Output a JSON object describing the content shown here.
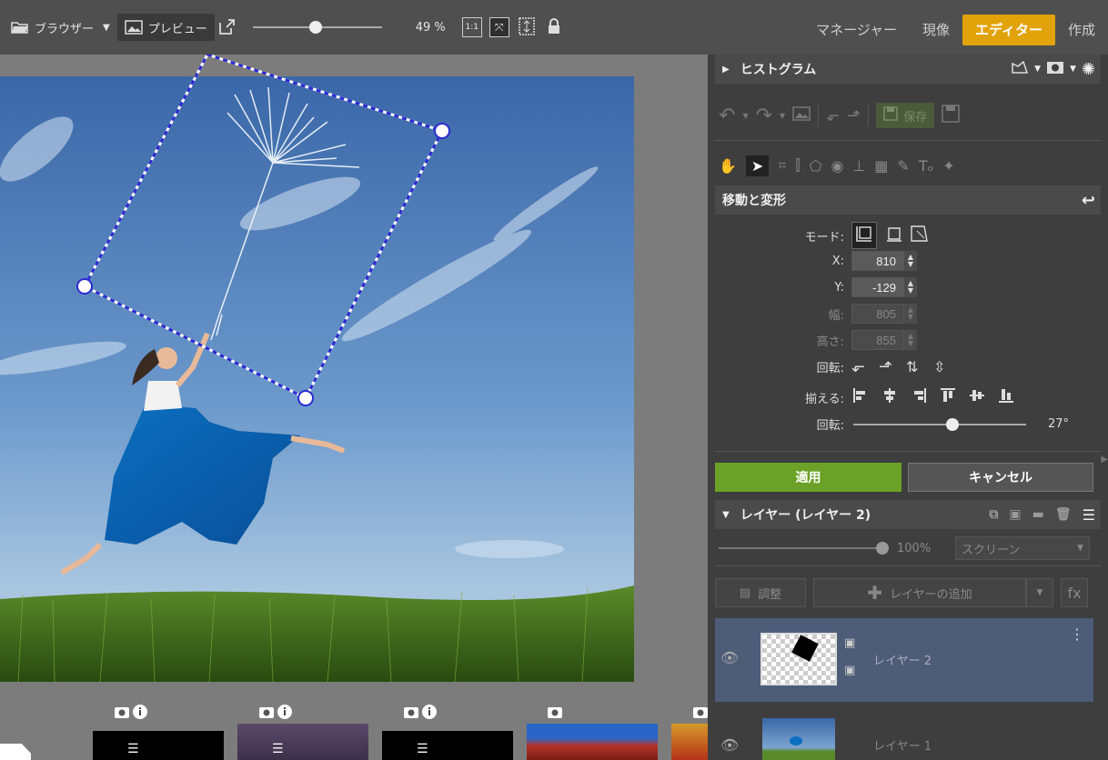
{
  "topbar": {
    "browser_label": "ブラウザー",
    "preview_label": "プレビュー",
    "zoom_value": 49,
    "zoom_label": "49 %",
    "actual_size_label": "1:1"
  },
  "modes": {
    "manager": "マネージャー",
    "develop": "現像",
    "editor": "エディター",
    "create": "作成"
  },
  "histogram": {
    "title": "ヒストグラム"
  },
  "toolbar": {
    "save_label": "保存"
  },
  "transform": {
    "title": "移動と変形",
    "mode_label": "モード:",
    "x_label": "X:",
    "x_value": "810",
    "y_label": "Y:",
    "y_value": "-129",
    "width_label": "幅:",
    "width_value": "805",
    "height_label": "高さ:",
    "height_value": "855",
    "rotate_label": "回転:",
    "align_label": "揃える:",
    "angle_label": "回転:",
    "angle_value": 27,
    "angle_text": "27°",
    "apply_label": "適用",
    "cancel_label": "キャンセル"
  },
  "layers": {
    "title": "レイヤー (レイヤー 2)",
    "opacity_value": 100,
    "opacity_label": "100%",
    "blend_mode": "スクリーン",
    "adjust_label": "調整",
    "add_layer_label": "レイヤーの追加",
    "fx_label": "fx",
    "items": [
      {
        "name": "レイヤー 2"
      },
      {
        "name": "レイヤー 1"
      }
    ]
  },
  "colors": {
    "accent": "#e2a20a",
    "apply": "#6aa126",
    "selection": "#2b2bd0",
    "layer_selected": "#4d5d78"
  }
}
